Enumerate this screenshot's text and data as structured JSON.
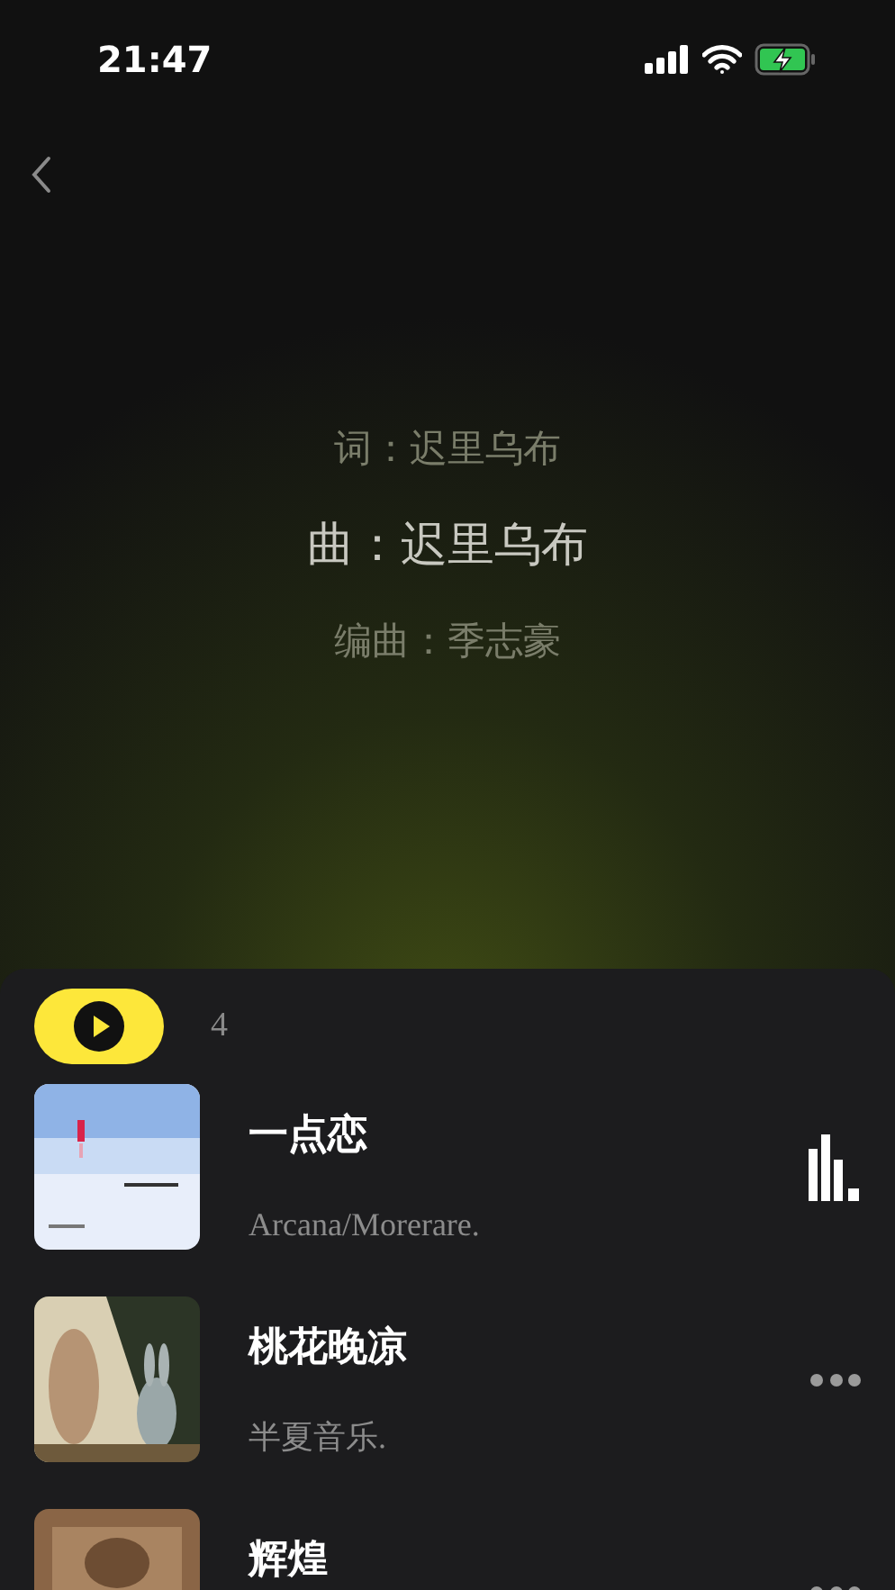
{
  "status_bar": {
    "time": "21:47"
  },
  "credits": [
    {
      "text": "词：迟里乌布",
      "current": false
    },
    {
      "text": "曲：迟里乌布",
      "current": true
    },
    {
      "text": "编曲：季志豪",
      "current": false
    }
  ],
  "playlist": {
    "count": "4",
    "songs": [
      {
        "title": "一点恋",
        "artist": "Arcana/Morerare.",
        "kind": "playing"
      },
      {
        "title": "桃花晚凉",
        "artist": "半夏音乐.",
        "kind": "more"
      },
      {
        "title": "辉煌",
        "kind": "more"
      }
    ]
  }
}
